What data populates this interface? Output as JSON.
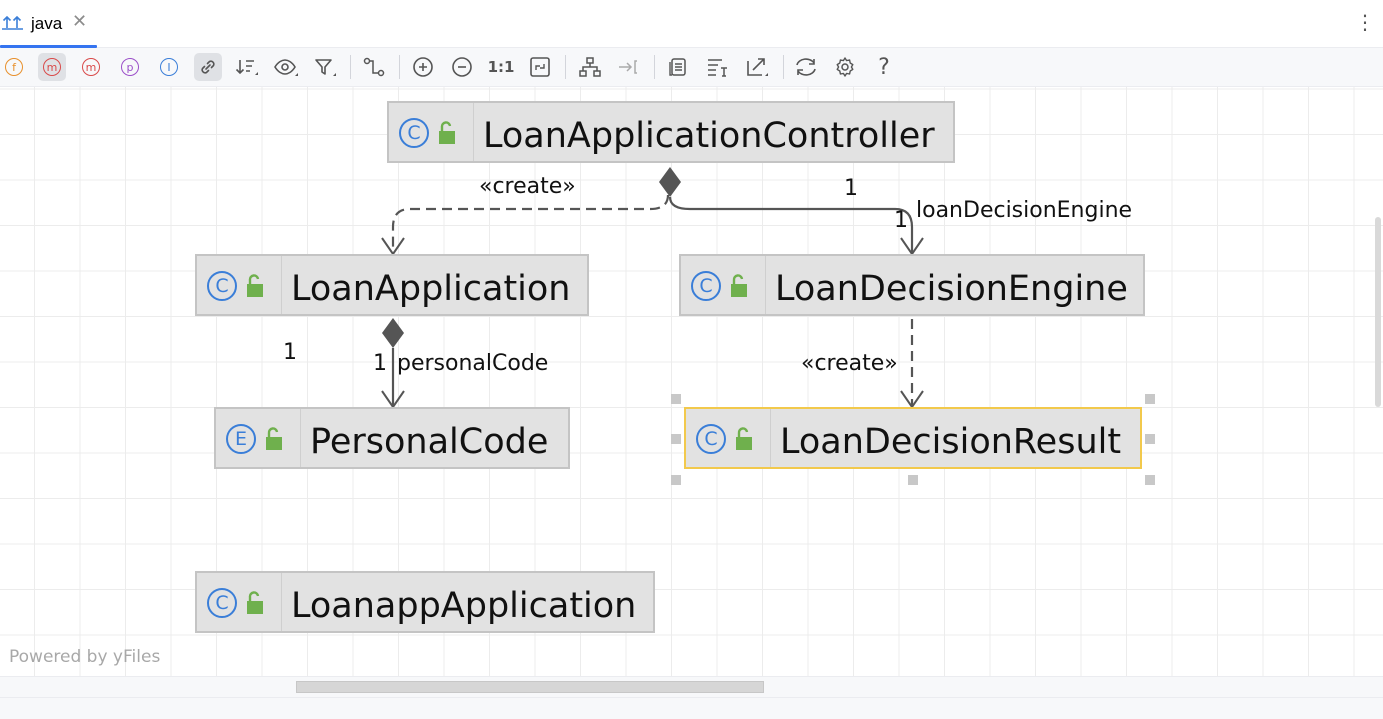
{
  "tab": {
    "label": "java",
    "close_glyph": "✕"
  },
  "toolbar": {
    "items": [
      {
        "name": "fields-filter-icon",
        "letter": "f",
        "color": "#e8902c"
      },
      {
        "name": "constructors-filter-icon",
        "letter": "m",
        "color": "#d94a4a"
      },
      {
        "name": "methods-filter-icon",
        "letter": "m",
        "color": "#d94a4a"
      },
      {
        "name": "properties-filter-icon",
        "letter": "p",
        "color": "#9b4fc9"
      },
      {
        "name": "inner-classes-filter-icon",
        "letter": "I",
        "color": "#3a7ed8"
      }
    ],
    "actual_size_label": "1:1",
    "help_glyph": "?"
  },
  "nodes": [
    {
      "name": "LoanApplicationController",
      "kind": "C"
    },
    {
      "name": "LoanApplication",
      "kind": "C"
    },
    {
      "name": "LoanDecisionEngine",
      "kind": "C"
    },
    {
      "name": "PersonalCode",
      "kind": "E"
    },
    {
      "name": "LoanDecisionResult",
      "kind": "C"
    },
    {
      "name": "LoanappApplication",
      "kind": "C"
    }
  ],
  "edge_labels": {
    "create_left": "«create»",
    "mult_top_right": "1",
    "mult_engine": "1",
    "role_engine": "loanDecisionEngine",
    "mult_left": "1",
    "mult_personal": "1",
    "role_personal": "personalCode",
    "create_right": "«create»"
  },
  "footer": {
    "powered_by": "Powered by yFiles"
  },
  "colors": {
    "accent": "#3574f0",
    "class_icon": "#3a7ed8",
    "lock": "#6fb04d",
    "selection": "#f2c94c"
  }
}
